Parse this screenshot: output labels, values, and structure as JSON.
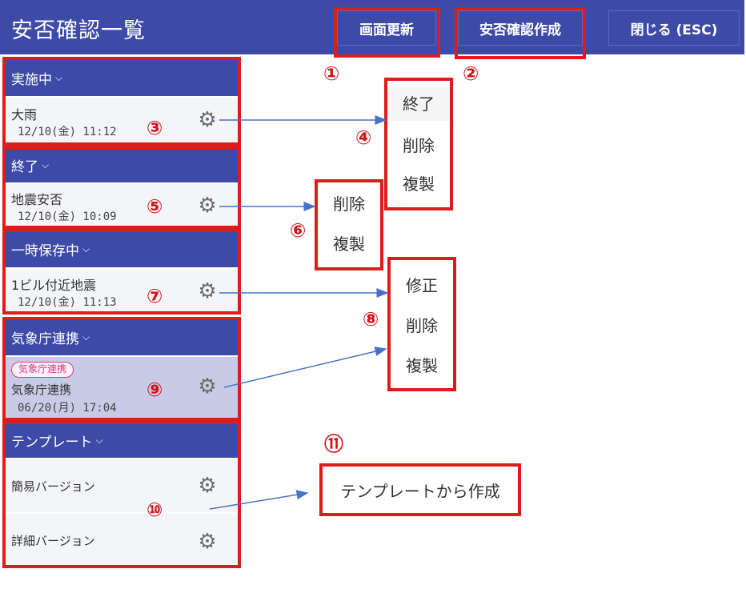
{
  "header": {
    "title": "安否確認一覧",
    "refresh_label": "画面更新",
    "create_label": "安否確認作成",
    "close_label": "閉じる (ESC)"
  },
  "sections": {
    "active": {
      "label": "実施中",
      "item": {
        "title": "大雨",
        "date": "12/10(金) 11:12"
      }
    },
    "ended": {
      "label": "終了",
      "item": {
        "title": "地震安否",
        "date": "12/10(金) 10:09"
      }
    },
    "draft": {
      "label": "一時保存中",
      "item": {
        "title": "1ビル付近地震",
        "date": "12/10(金) 11:13"
      }
    },
    "jma": {
      "label": "気象庁連携",
      "item": {
        "badge": "気象庁連携",
        "title": "気象庁連携",
        "date": "06/20(月) 17:04"
      }
    },
    "template": {
      "label": "テンプレート",
      "items": [
        {
          "title": "簡易バージョン"
        },
        {
          "title": "詳細バージョン"
        }
      ]
    }
  },
  "menus": {
    "active_menu": [
      "終了",
      "削除",
      "複製"
    ],
    "ended_menu": [
      "削除",
      "複製"
    ],
    "draft_menu": [
      "修正",
      "削除",
      "複製"
    ],
    "template_action": "テンプレートから作成"
  },
  "callouts": [
    "①",
    "②",
    "③",
    "④",
    "⑤",
    "⑥",
    "⑦",
    "⑧",
    "⑨",
    "⑩",
    "⑪"
  ],
  "icons": {
    "settings": "gear-icon",
    "expand": "chevron-down-icon"
  },
  "colors": {
    "brand": "#3d4aa8",
    "highlight": "#e11b1b",
    "callout": "#d0141a",
    "badge": "#d93a8a"
  }
}
